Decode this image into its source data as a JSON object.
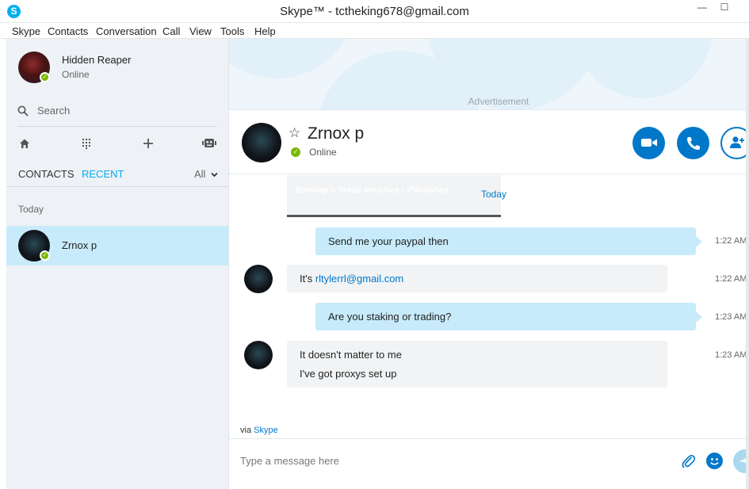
{
  "window": {
    "title": "Skype™ - tctheking678@gmail.com",
    "app_icon": "S",
    "minimize": "—",
    "maximize": "☐"
  },
  "menu": [
    "Skype",
    "Contacts",
    "Conversation",
    "Call",
    "View",
    "Tools",
    "Help"
  ],
  "profile": {
    "name": "Hidden Reaper",
    "status": "Online"
  },
  "sidebar": {
    "search_label": "Search",
    "tabs": {
      "contacts": "CONTACTS",
      "recent": "RECENT"
    },
    "filter": "All",
    "section": "Today",
    "recent_items": [
      {
        "name": "Zrnox p"
      }
    ],
    "icons": [
      "home-icon",
      "dialpad-icon",
      "add-icon",
      "bot-icon"
    ]
  },
  "ad": {
    "label": "Advertisement"
  },
  "conversation": {
    "name": "Zrnox p",
    "status": "Online",
    "link_preview": {
      "title": "Zombap's Trade vouches : r/Vouches",
      "url": "GIF www.reddit.com",
      "date": "Today"
    },
    "messages": [
      {
        "direction": "out",
        "lines": [
          "Send me your paypal then"
        ],
        "time": "1:22 AM"
      },
      {
        "direction": "in",
        "lines": [
          "It's "
        ],
        "link": "rltylerrl@gmail.com",
        "time": "1:22 AM"
      },
      {
        "direction": "out",
        "lines": [
          "Are you staking or trading?"
        ],
        "time": "1:23 AM"
      },
      {
        "direction": "in",
        "lines": [
          "It doesn't matter to me",
          "I've got proxys set up"
        ],
        "time": "1:23 AM"
      }
    ],
    "via": {
      "prefix": "via ",
      "link": "Skype"
    },
    "composer_placeholder": "Type a message here"
  },
  "colors": {
    "accent": "#00aff0",
    "call_button": "#0078ca",
    "online": "#7ab800",
    "selected": "#c7ebfb"
  }
}
